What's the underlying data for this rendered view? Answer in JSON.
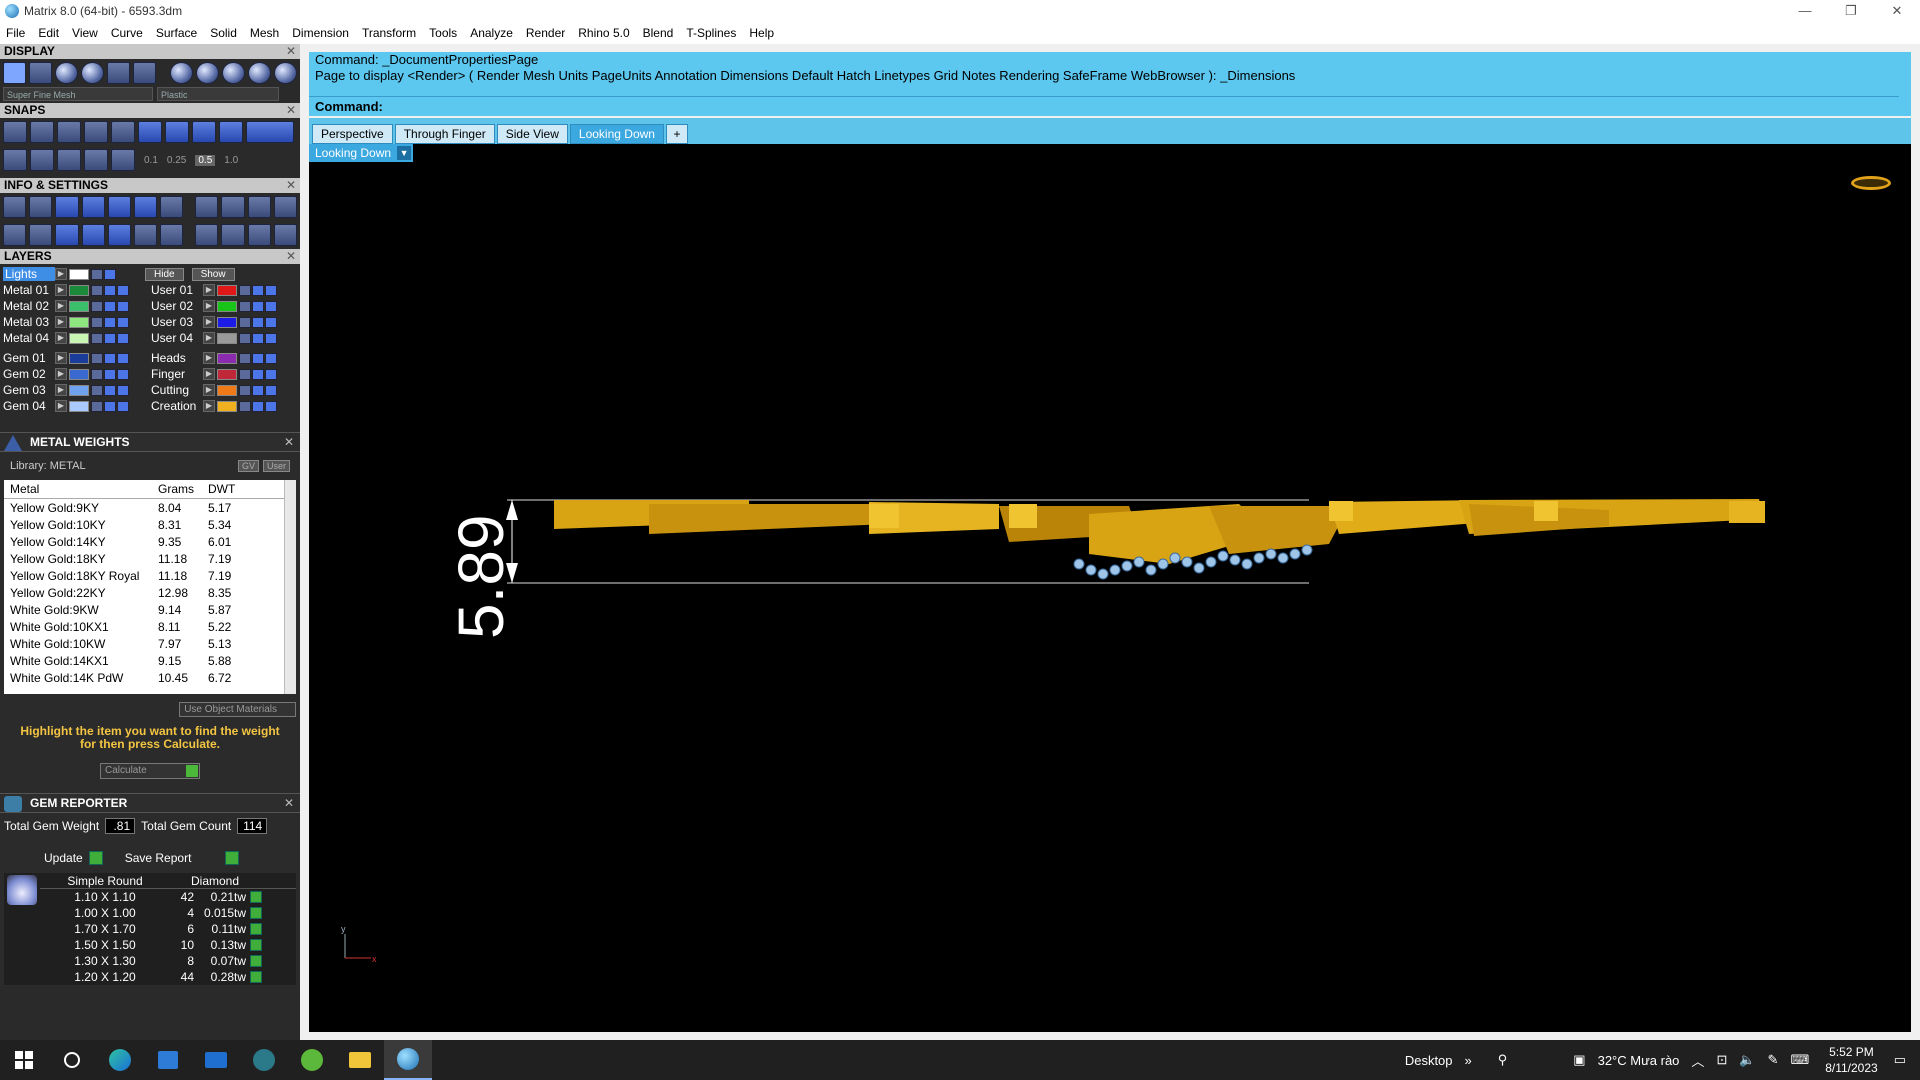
{
  "window": {
    "title": "Matrix 8.0 (64-bit) - 6593.3dm",
    "minimize": "—",
    "maximize": "❐",
    "close": "✕"
  },
  "menu": [
    "File",
    "Edit",
    "View",
    "Curve",
    "Surface",
    "Solid",
    "Mesh",
    "Dimension",
    "Transform",
    "Tools",
    "Analyze",
    "Render",
    "Rhino 5.0",
    "Blend",
    "T-Splines",
    "Help"
  ],
  "display": {
    "header": "DISPLAY",
    "mesh_combo": "Super Fine Mesh",
    "material_combo": "Plastic"
  },
  "snaps": {
    "header": "SNAPS",
    "values": [
      "0.1",
      "0.25",
      "0.5",
      "1.0"
    ]
  },
  "info": {
    "header": "INFO & SETTINGS"
  },
  "layers": {
    "header": "LAYERS",
    "lights_label": "Lights",
    "hide_label": "Hide",
    "show_label": "Show",
    "left": [
      {
        "name": "Metal 01",
        "color": "#1a8a3a"
      },
      {
        "name": "Metal 02",
        "color": "#3cbf6a"
      },
      {
        "name": "Metal 03",
        "color": "#8ee87f"
      },
      {
        "name": "Metal 04",
        "color": "#c9f5b4"
      },
      {
        "name": "Gem 01",
        "color": "#1a3c9a"
      },
      {
        "name": "Gem 02",
        "color": "#3a6ad0"
      },
      {
        "name": "Gem 03",
        "color": "#6fa3ef"
      },
      {
        "name": "Gem 04",
        "color": "#a9c9ff"
      }
    ],
    "right": [
      {
        "name": "User 01",
        "color": "#e01818"
      },
      {
        "name": "User 02",
        "color": "#19c419"
      },
      {
        "name": "User 03",
        "color": "#1c1ce6"
      },
      {
        "name": "User 04",
        "color": "#9a9a9a"
      },
      {
        "name": "Heads",
        "color": "#8a2bb0"
      },
      {
        "name": "Finger",
        "color": "#c0283a"
      },
      {
        "name": "Cutting",
        "color": "#f07a18"
      },
      {
        "name": "Creation",
        "color": "#f0b020"
      }
    ]
  },
  "metal_weights": {
    "header": "METAL WEIGHTS",
    "library": "Library: METAL",
    "gv_label": "GV",
    "user_label": "User",
    "columns": [
      "Metal",
      "Grams",
      "DWT"
    ],
    "rows": [
      [
        "Yellow Gold:9KY",
        "8.04",
        "5.17"
      ],
      [
        "Yellow Gold:10KY",
        "8.31",
        "5.34"
      ],
      [
        "Yellow Gold:14KY",
        "9.35",
        "6.01"
      ],
      [
        "Yellow Gold:18KY",
        "11.18",
        "7.19"
      ],
      [
        "Yellow Gold:18KY Royal",
        "11.18",
        "7.19"
      ],
      [
        "Yellow Gold:22KY",
        "12.98",
        "8.35"
      ],
      [
        "White Gold:9KW",
        "9.14",
        "5.87"
      ],
      [
        "White Gold:10KX1",
        "8.11",
        "5.22"
      ],
      [
        "White Gold:10KW",
        "7.97",
        "5.13"
      ],
      [
        "White Gold:14KX1",
        "9.15",
        "5.88"
      ],
      [
        "White Gold:14K PdW",
        "10.45",
        "6.72"
      ]
    ],
    "use_object_materials": "Use Object Materials",
    "instruction": "Highlight the item you want to find the weight for then press Calculate.",
    "calculate_label": "Calculate"
  },
  "gem_reporter": {
    "header": "GEM REPORTER",
    "total_weight_label": "Total Gem Weight",
    "total_weight": ".81",
    "total_count_label": "Total Gem Count",
    "total_count": "114",
    "update_label": "Update",
    "save_label": "Save Report",
    "columns": [
      "Simple Round",
      "Diamond"
    ],
    "rows": [
      [
        "1.10 X 1.10",
        "42",
        "0.21tw"
      ],
      [
        "1.00 X 1.00",
        "4",
        "0.015tw"
      ],
      [
        "1.70 X 1.70",
        "6",
        "0.11tw"
      ],
      [
        "1.50 X 1.50",
        "10",
        "0.13tw"
      ],
      [
        "1.30 X 1.30",
        "8",
        "0.07tw"
      ],
      [
        "1.20 X 1.20",
        "44",
        "0.28tw"
      ]
    ]
  },
  "command": {
    "line1": "Command: _DocumentPropertiesPage",
    "line2": "Page to display <Render> ( Render  Mesh  Units  PageUnits  Annotation  Dimensions  Default  Hatch  Linetypes  Grid  Notes  Rendering  SafeFrame  WebBrowser ): _Dimensions",
    "prompt": "Command:"
  },
  "tabs": [
    "Perspective",
    "Through Finger",
    "Side View",
    "Looking Down"
  ],
  "active_tab": "Looking Down",
  "viewport": {
    "label": "Looking Down",
    "dimension": "5.89",
    "axis_x": "x",
    "axis_y": "y"
  },
  "taskbar": {
    "desktop": "Desktop",
    "weather": "32°C  Mưa rào",
    "time": "5:52 PM",
    "date": "8/11/2023"
  }
}
